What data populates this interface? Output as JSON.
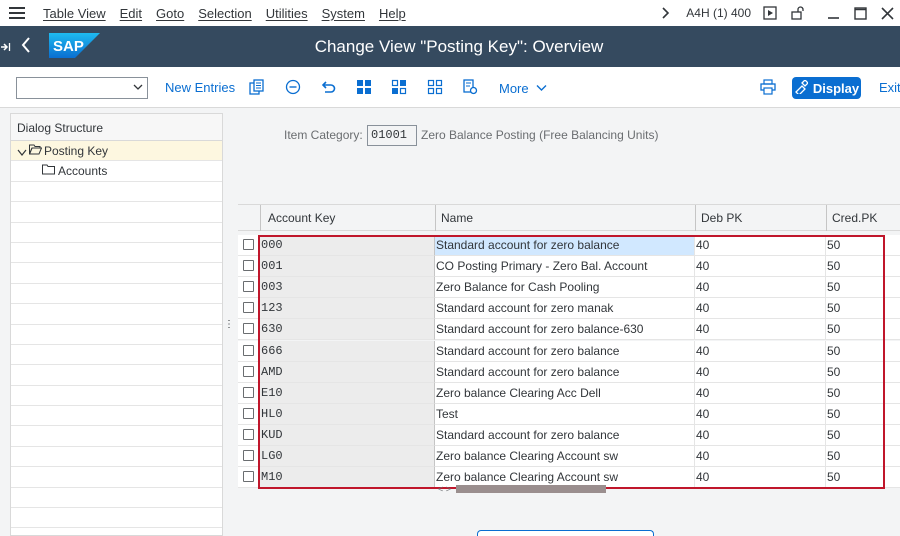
{
  "menubar": {
    "items": [
      "Table View",
      "Edit",
      "Goto",
      "Selection",
      "Utilities",
      "System",
      "Help"
    ],
    "system_info": "A4H (1) 400"
  },
  "titlebar": {
    "title": "Change View \"Posting Key\": Overview",
    "logo_text": "SAP"
  },
  "toolbar": {
    "select_value": "",
    "new_entries_label": "New Entries",
    "more_label": "More",
    "display_label": "Display",
    "exit_label": "Exit"
  },
  "dialog_structure": {
    "header": "Dialog Structure",
    "items": [
      {
        "label": "Posting Key",
        "level": 0,
        "expanded": true,
        "selected": true
      },
      {
        "label": "Accounts",
        "level": 1,
        "expanded": false,
        "selected": false
      }
    ]
  },
  "item_category": {
    "label": "Item Category:",
    "value": "01001",
    "description": "Zero Balance Posting (Free Balancing Units)"
  },
  "table": {
    "columns": [
      "Account Key",
      "Name",
      "Deb PK",
      "Cred.PK"
    ],
    "rows": [
      {
        "key": "000",
        "name": "Standard account for zero balance",
        "deb": "40",
        "cred": "50"
      },
      {
        "key": "001",
        "name": "CO Posting Primary - Zero Bal. Account",
        "deb": "40",
        "cred": "50"
      },
      {
        "key": "003",
        "name": "Zero Balance for Cash Pooling",
        "deb": "40",
        "cred": "50"
      },
      {
        "key": "123",
        "name": "Standard account for zero manak",
        "deb": "40",
        "cred": "50"
      },
      {
        "key": "630",
        "name": "Standard account for zero balance-630",
        "deb": "40",
        "cred": "50"
      },
      {
        "key": "666",
        "name": "Standard account for zero balance",
        "deb": "40",
        "cred": "50"
      },
      {
        "key": "AMD",
        "name": "Standard account for zero balance",
        "deb": "40",
        "cred": "50"
      },
      {
        "key": "E10",
        "name": "Zero balance Clearing Acc Dell",
        "deb": "40",
        "cred": "50"
      },
      {
        "key": "HL0",
        "name": "Test",
        "deb": "40",
        "cred": "50"
      },
      {
        "key": "KUD",
        "name": "Standard account for zero balance",
        "deb": "40",
        "cred": "50"
      },
      {
        "key": "LG0",
        "name": "Zero balance Clearing Account sw",
        "deb": "40",
        "cred": "50"
      },
      {
        "key": "M10",
        "name": "Zero balance Clearing Account sw",
        "deb": "40",
        "cred": "50"
      }
    ]
  },
  "colors": {
    "title_bar": "#354a5f",
    "accent": "#0a6ed1",
    "highlight_box": "#c0162b",
    "selected_tree_row": "#fdf7e0",
    "active_cell": "#d1e8ff"
  },
  "icons": {
    "menubar": [
      "hamburger-icon",
      "chevron-right-icon",
      "run-icon",
      "unlock-icon",
      "minimize-icon",
      "maximize-icon",
      "close-icon"
    ],
    "titlebar": [
      "exit-arrow-icon",
      "back-icon"
    ],
    "toolbar": [
      "copy-icon",
      "delete-icon",
      "undo-icon",
      "select-all-icon",
      "deselect-all-icon",
      "configure-icon",
      "print-icon",
      "glasses-icon"
    ]
  }
}
